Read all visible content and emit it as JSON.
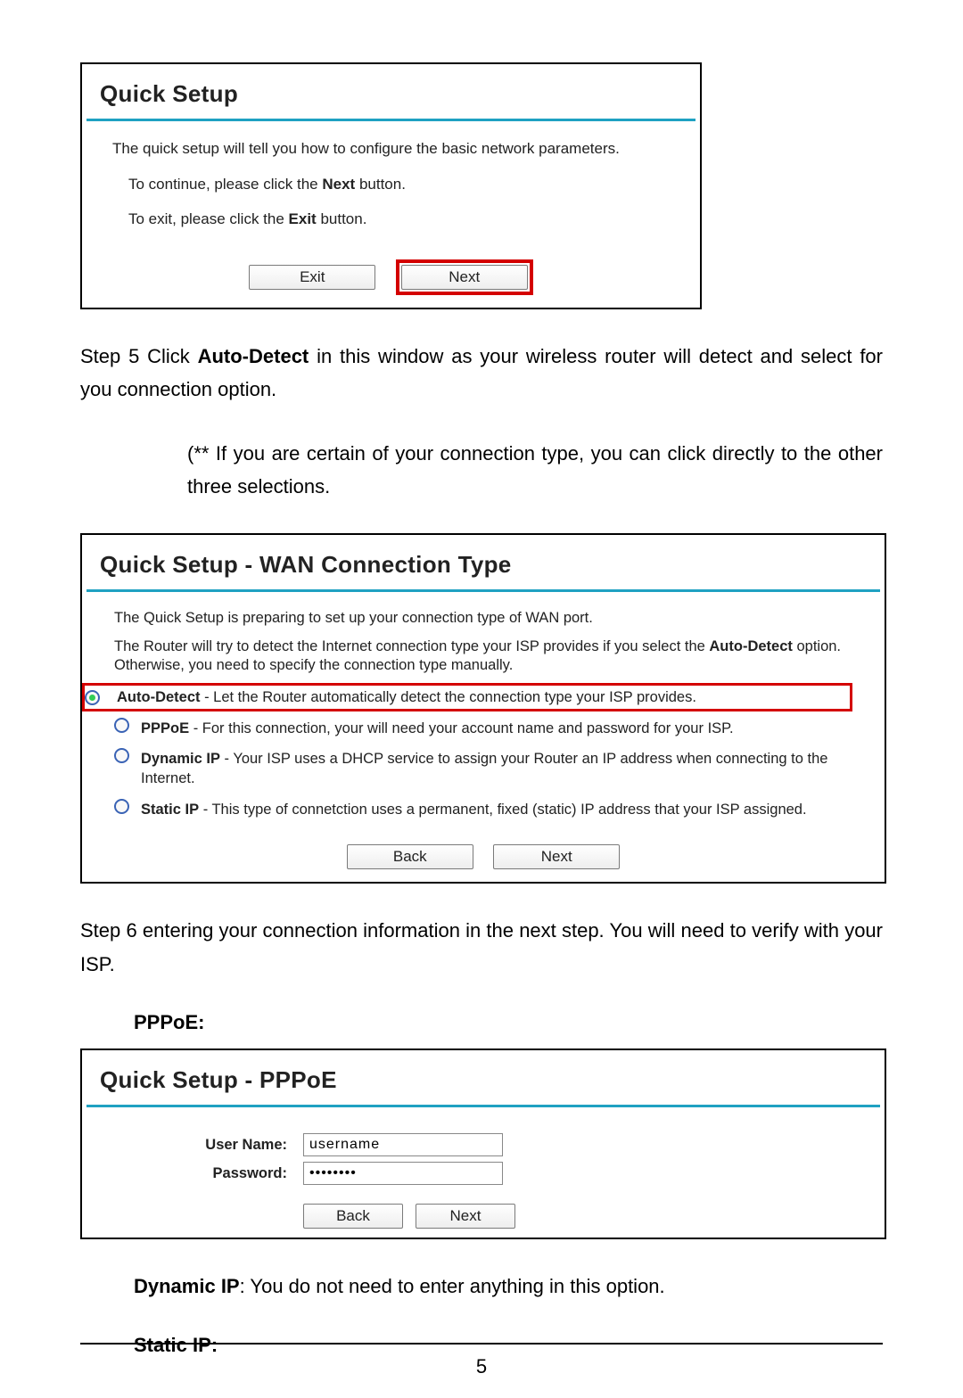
{
  "frame1": {
    "title": "Quick Setup",
    "intro": "The quick setup will tell you how to configure the basic network parameters.",
    "continue_prefix": "To continue, please click the ",
    "continue_bold": "Next",
    "continue_suffix": " button.",
    "exit_prefix": "To exit, please click the ",
    "exit_bold": "Exit",
    "exit_suffix": "  button.",
    "btn_exit": "Exit",
    "btn_next": "Next"
  },
  "step5": {
    "prefix": "Step 5 Click ",
    "bold": "Auto-Detect",
    "suffix": " in this window as your wireless router will detect and select for you connection option."
  },
  "note": "(** If you are certain of your connection type, you can click directly to the other three selections.",
  "frame2": {
    "title": "Quick Setup - WAN Connection Type",
    "line1": "The Quick Setup is preparing to set up your connection type of WAN port.",
    "line2a": "The Router will try to detect the Internet connection type your ISP provides if you select the ",
    "line2b": "Auto-Detect",
    "line2c": " option. Otherwise, you need to specify the connection type manually.",
    "options": [
      {
        "label": "Auto-Detect",
        "desc": " - Let the Router automatically detect the connection type your ISP provides.",
        "selected": true,
        "highlight": true
      },
      {
        "label": "PPPoE",
        "desc": " - For this connection, your will need your account name and password for your ISP.",
        "selected": false,
        "highlight": false
      },
      {
        "label": "Dynamic IP",
        "desc": " - Your ISP uses a DHCP service to assign your Router an IP address when connecting to the Internet.",
        "selected": false,
        "highlight": false
      },
      {
        "label": "Static IP",
        "desc": " - This type of connetction uses a permanent, fixed (static) IP address that your ISP assigned.",
        "selected": false,
        "highlight": false
      }
    ],
    "btn_back": "Back",
    "btn_next": "Next"
  },
  "step6": "Step 6 entering your connection information in the next step. You will need to verify with your ISP.",
  "pppoe_heading": "PPPoE",
  "frame3": {
    "title": "Quick Setup - PPPoE",
    "label_user": "User Name:",
    "label_pass": "Password:",
    "value_user": "username",
    "value_pass": "••••••••",
    "btn_back": "Back",
    "btn_next": "Next"
  },
  "dynamicip": {
    "bold": "Dynamic IP",
    "text": ": You do not need to enter anything in this option."
  },
  "staticip": {
    "bold": "Static IP",
    "text": ":"
  },
  "page_number": "5"
}
